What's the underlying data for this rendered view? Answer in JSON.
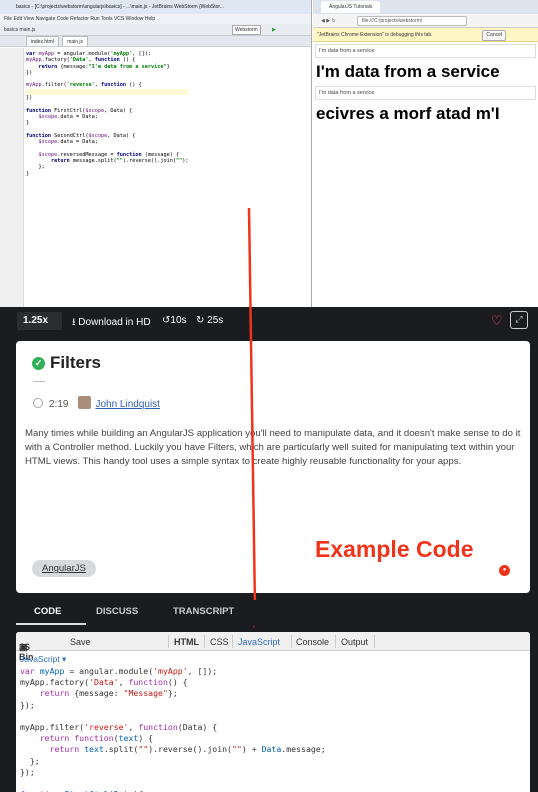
{
  "ide": {
    "title": "basics - [C:\\projects\\webstorm\\angularjs\\basics] - ...\\main.js - JetBrains WebStorm (WebStor...",
    "menu": [
      "File",
      "Edit",
      "View",
      "Navigate",
      "Code",
      "Refactor",
      "Run",
      "Tools",
      "VCS",
      "Window",
      "Help"
    ],
    "breadcrumb": "basics  main.js",
    "run_config": "Webstorm",
    "tabs": [
      "index.html",
      "main.js"
    ],
    "code_lines": [
      "var myApp = angular.module('myApp', []);",
      "myApp.factory('Data', function () {",
      "    return {message:\"I'm data from a service\"}",
      "})",
      "",
      "myApp.filter('reverse', function () {",
      "",
      "})",
      "",
      "function FirstCtrl($scope, Data) {",
      "    $scope.data = Data;",
      "}",
      "",
      "function SecondCtrl($scope, Data) {",
      "    $scope.data = Data;",
      "",
      "    $scope.reversedMessage = function (message) {",
      "        return message.split(\"\").reverse().join(\"\");",
      "    };",
      "}"
    ]
  },
  "browser": {
    "tab_title": "AngularJS Tutorials",
    "url": "file:///C:/projects/webstorm/",
    "notice": "\"JetBrains Chrome Extension\" is debugging this tab.",
    "notice_cancel": "Cancel",
    "input1": "I'm data from a service",
    "heading1": "I'm data from a service",
    "input2": "I'm data from a service",
    "heading2": "ecivres a morf atad m'I"
  },
  "controls": {
    "speed": "1.25x",
    "download": "Download in HD",
    "rewind": "10s",
    "forward": "25s"
  },
  "lesson": {
    "title": "Filters",
    "duration": "2:19",
    "author": "John Lindquist",
    "description": "Many times while building an AngularJS application you'll need to manipulate data, and it doesn't make sense to do it with a Controller method. Luckily you have Filters, which are particularly well suited for manipulating text within your HTML views. This handy tool uses a simple syntax to create highly reusable functionality for your apps.",
    "example_code": "Example Code",
    "tag": "AngularJS"
  },
  "tabs": [
    "CODE",
    "DISCUSS",
    "TRANSCRIPT"
  ],
  "jsbin": {
    "logo": "JS Bin",
    "save": "Save",
    "panels": [
      "HTML",
      "CSS",
      "JavaScript",
      "Console",
      "Output"
    ],
    "language": "JavaScript"
  },
  "colors": {
    "annotation_red": "#f0341b",
    "check_green": "#35b05a",
    "heart": "#ff4f5a",
    "link_blue": "#2f5fb3"
  }
}
